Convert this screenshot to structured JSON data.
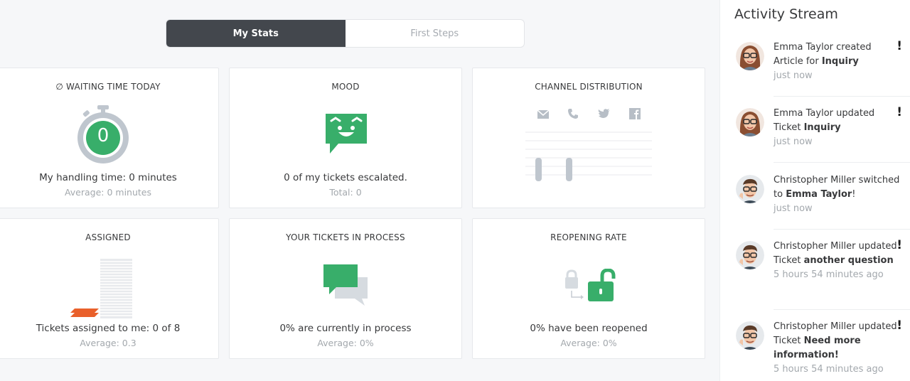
{
  "toggle": {
    "active_label": "My Stats",
    "inactive_label": "First Steps"
  },
  "cards": {
    "waiting": {
      "title": "∅ WAITING TIME TODAY",
      "value": "0",
      "main": "My handling time: 0 minutes",
      "sub": "Average: 0 minutes"
    },
    "mood": {
      "title": "MOOD",
      "main": "0 of my tickets escalated.",
      "sub": "Total: 0"
    },
    "channel": {
      "title": "CHANNEL DISTRIBUTION",
      "icons": [
        "mail-icon",
        "phone-icon",
        "twitter-icon",
        "facebook-icon"
      ]
    },
    "assigned": {
      "title": "ASSIGNED",
      "main": "Tickets assigned to me: 0 of 8",
      "sub": "Average: 0.3"
    },
    "in_process": {
      "title": "YOUR TICKETS IN PROCESS",
      "main": "0% are currently in process",
      "sub": "Average: 0%"
    },
    "reopening": {
      "title": "REOPENING RATE",
      "main": "0% have been reopened",
      "sub": "Average: 0%"
    }
  },
  "activity": {
    "title": "Activity Stream",
    "items": [
      {
        "pre": "Emma Taylor created Article for ",
        "bold": "Inquiry",
        "post": "",
        "time": "just now",
        "flag": "!"
      },
      {
        "pre": "Emma Taylor updated Ticket ",
        "bold": "Inquiry",
        "post": "",
        "time": "just now",
        "flag": "!"
      },
      {
        "pre": "Christopher Miller switched to ",
        "bold": "Emma Taylor",
        "post": "!",
        "time": "just now",
        "flag": ""
      },
      {
        "pre": "Christopher Miller updated Ticket ",
        "bold": "another question",
        "post": "",
        "time": "5 hours 54 minutes ago",
        "flag": "!"
      },
      {
        "pre": "Christopher Miller updated Ticket ",
        "bold": "Need more information!",
        "post": "",
        "time": "5 hours 54 minutes ago",
        "flag": "!"
      }
    ]
  },
  "colors": {
    "accent_green": "#38ae6a",
    "dark_toggle": "#43474d",
    "muted_text": "#a3a8ad",
    "stopwatch_gray": "#bfc6ce"
  }
}
